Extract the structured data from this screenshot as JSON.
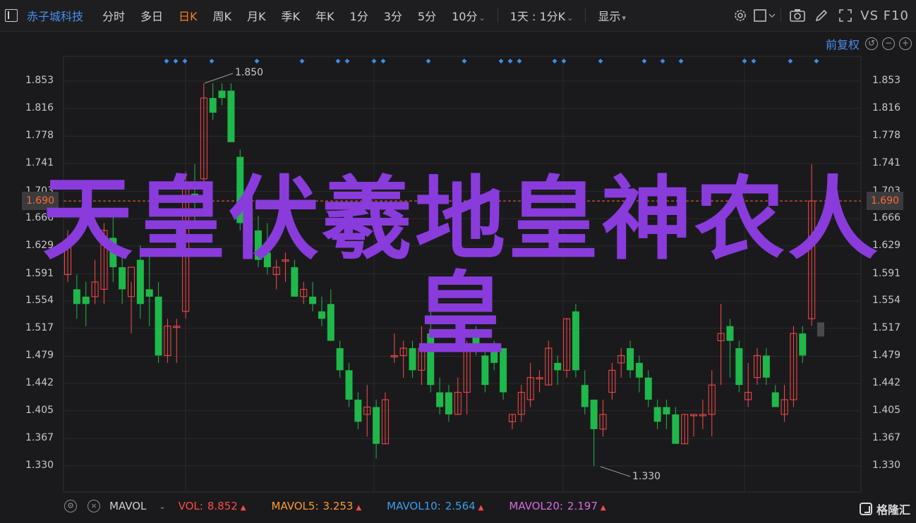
{
  "toolbar": {
    "stock_name": "赤子城科技",
    "periods": [
      "分时",
      "多日",
      "日K",
      "周K",
      "月K",
      "季K",
      "年K",
      "1分",
      "3分",
      "5分",
      "10分"
    ],
    "active_period": "日K",
    "combo_label": "1天 : 1分K",
    "display_label": "显示",
    "vs_label": "VS",
    "f10_label": "F10"
  },
  "chart": {
    "fq_label": "前复权",
    "price_levels": [
      "1.853",
      "1.816",
      "1.778",
      "1.741",
      "1.703",
      "1.666",
      "1.629",
      "1.591",
      "1.554",
      "1.517",
      "1.479",
      "1.442",
      "1.405",
      "1.367",
      "1.330"
    ],
    "current_price": "1.690",
    "high_annotation": "1.850",
    "low_annotation": "1.330",
    "colors": {
      "up": "#ff4a4a",
      "down": "#1fb84a",
      "current_line": "#ff6a33",
      "marker": "#3a8fe8"
    }
  },
  "chart_data": {
    "type": "candlestick",
    "ylim": [
      1.31,
      1.87
    ],
    "candles": [
      {
        "o": 1.59,
        "h": 1.65,
        "l": 1.58,
        "c": 1.63
      },
      {
        "o": 1.57,
        "h": 1.59,
        "l": 1.53,
        "c": 1.55
      },
      {
        "o": 1.56,
        "h": 1.58,
        "l": 1.52,
        "c": 1.55
      },
      {
        "o": 1.56,
        "h": 1.61,
        "l": 1.55,
        "c": 1.58
      },
      {
        "o": 1.57,
        "h": 1.66,
        "l": 1.55,
        "c": 1.65
      },
      {
        "o": 1.64,
        "h": 1.67,
        "l": 1.58,
        "c": 1.6
      },
      {
        "o": 1.6,
        "h": 1.62,
        "l": 1.55,
        "c": 1.57
      },
      {
        "o": 1.56,
        "h": 1.58,
        "l": 1.51,
        "c": 1.6
      },
      {
        "o": 1.61,
        "h": 1.63,
        "l": 1.53,
        "c": 1.55
      },
      {
        "o": 1.57,
        "h": 1.62,
        "l": 1.52,
        "c": 1.56
      },
      {
        "o": 1.56,
        "h": 1.58,
        "l": 1.47,
        "c": 1.48
      },
      {
        "o": 1.48,
        "h": 1.53,
        "l": 1.47,
        "c": 1.52
      },
      {
        "o": 1.52,
        "h": 1.53,
        "l": 1.47,
        "c": 1.52
      },
      {
        "o": 1.54,
        "h": 1.73,
        "l": 1.53,
        "c": 1.71
      },
      {
        "o": 1.7,
        "h": 1.74,
        "l": 1.66,
        "c": 1.69
      },
      {
        "o": 1.72,
        "h": 1.85,
        "l": 1.7,
        "c": 1.83
      },
      {
        "o": 1.83,
        "h": 1.85,
        "l": 1.8,
        "c": 1.81
      },
      {
        "o": 1.84,
        "h": 1.85,
        "l": 1.82,
        "c": 1.83
      },
      {
        "o": 1.84,
        "h": 1.85,
        "l": 1.77,
        "c": 1.77
      },
      {
        "o": 1.75,
        "h": 1.76,
        "l": 1.65,
        "c": 1.66
      },
      {
        "o": 1.68,
        "h": 1.7,
        "l": 1.62,
        "c": 1.63
      },
      {
        "o": 1.65,
        "h": 1.67,
        "l": 1.6,
        "c": 1.61
      },
      {
        "o": 1.62,
        "h": 1.66,
        "l": 1.59,
        "c": 1.6
      },
      {
        "o": 1.59,
        "h": 1.61,
        "l": 1.57,
        "c": 1.6
      },
      {
        "o": 1.61,
        "h": 1.62,
        "l": 1.58,
        "c": 1.61
      },
      {
        "o": 1.6,
        "h": 1.61,
        "l": 1.56,
        "c": 1.56
      },
      {
        "o": 1.56,
        "h": 1.58,
        "l": 1.55,
        "c": 1.57
      },
      {
        "o": 1.56,
        "h": 1.58,
        "l": 1.54,
        "c": 1.55
      },
      {
        "o": 1.54,
        "h": 1.56,
        "l": 1.52,
        "c": 1.53
      },
      {
        "o": 1.55,
        "h": 1.57,
        "l": 1.5,
        "c": 1.5
      },
      {
        "o": 1.49,
        "h": 1.5,
        "l": 1.45,
        "c": 1.46
      },
      {
        "o": 1.46,
        "h": 1.47,
        "l": 1.41,
        "c": 1.42
      },
      {
        "o": 1.42,
        "h": 1.43,
        "l": 1.38,
        "c": 1.39
      },
      {
        "o": 1.4,
        "h": 1.44,
        "l": 1.37,
        "c": 1.41
      },
      {
        "o": 1.41,
        "h": 1.42,
        "l": 1.34,
        "c": 1.36
      },
      {
        "o": 1.36,
        "h": 1.43,
        "l": 1.36,
        "c": 1.42
      },
      {
        "o": 1.48,
        "h": 1.51,
        "l": 1.47,
        "c": 1.48
      },
      {
        "o": 1.48,
        "h": 1.5,
        "l": 1.45,
        "c": 1.49
      },
      {
        "o": 1.49,
        "h": 1.5,
        "l": 1.45,
        "c": 1.46
      },
      {
        "o": 1.46,
        "h": 1.52,
        "l": 1.44,
        "c": 1.49
      },
      {
        "o": 1.51,
        "h": 1.54,
        "l": 1.43,
        "c": 1.44
      },
      {
        "o": 1.43,
        "h": 1.45,
        "l": 1.4,
        "c": 1.41
      },
      {
        "o": 1.43,
        "h": 1.44,
        "l": 1.39,
        "c": 1.4
      },
      {
        "o": 1.4,
        "h": 1.45,
        "l": 1.4,
        "c": 1.43
      },
      {
        "o": 1.43,
        "h": 1.5,
        "l": 1.4,
        "c": 1.49
      },
      {
        "o": 1.51,
        "h": 1.52,
        "l": 1.48,
        "c": 1.49
      },
      {
        "o": 1.48,
        "h": 1.49,
        "l": 1.43,
        "c": 1.44
      },
      {
        "o": 1.49,
        "h": 1.5,
        "l": 1.46,
        "c": 1.47
      },
      {
        "o": 1.49,
        "h": 1.49,
        "l": 1.42,
        "c": 1.43
      },
      {
        "o": 1.39,
        "h": 1.4,
        "l": 1.38,
        "c": 1.4
      },
      {
        "o": 1.4,
        "h": 1.44,
        "l": 1.39,
        "c": 1.43
      },
      {
        "o": 1.42,
        "h": 1.47,
        "l": 1.41,
        "c": 1.45
      },
      {
        "o": 1.45,
        "h": 1.46,
        "l": 1.43,
        "c": 1.45
      },
      {
        "o": 1.44,
        "h": 1.5,
        "l": 1.44,
        "c": 1.49
      },
      {
        "o": 1.47,
        "h": 1.48,
        "l": 1.44,
        "c": 1.46
      },
      {
        "o": 1.46,
        "h": 1.53,
        "l": 1.45,
        "c": 1.53
      },
      {
        "o": 1.54,
        "h": 1.55,
        "l": 1.45,
        "c": 1.46
      },
      {
        "o": 1.44,
        "h": 1.46,
        "l": 1.4,
        "c": 1.41
      },
      {
        "o": 1.42,
        "h": 1.42,
        "l": 1.33,
        "c": 1.38
      },
      {
        "o": 1.38,
        "h": 1.42,
        "l": 1.37,
        "c": 1.4
      },
      {
        "o": 1.43,
        "h": 1.47,
        "l": 1.42,
        "c": 1.46
      },
      {
        "o": 1.47,
        "h": 1.49,
        "l": 1.45,
        "c": 1.48
      },
      {
        "o": 1.49,
        "h": 1.5,
        "l": 1.45,
        "c": 1.46
      },
      {
        "o": 1.47,
        "h": 1.48,
        "l": 1.43,
        "c": 1.45
      },
      {
        "o": 1.45,
        "h": 1.46,
        "l": 1.41,
        "c": 1.42
      },
      {
        "o": 1.41,
        "h": 1.42,
        "l": 1.38,
        "c": 1.39
      },
      {
        "o": 1.41,
        "h": 1.42,
        "l": 1.38,
        "c": 1.4
      },
      {
        "o": 1.4,
        "h": 1.41,
        "l": 1.36,
        "c": 1.36
      },
      {
        "o": 1.36,
        "h": 1.4,
        "l": 1.36,
        "c": 1.4
      },
      {
        "o": 1.4,
        "h": 1.4,
        "l": 1.37,
        "c": 1.4
      },
      {
        "o": 1.4,
        "h": 1.42,
        "l": 1.38,
        "c": 1.4
      },
      {
        "o": 1.4,
        "h": 1.46,
        "l": 1.37,
        "c": 1.44
      },
      {
        "o": 1.5,
        "h": 1.55,
        "l": 1.44,
        "c": 1.51
      },
      {
        "o": 1.52,
        "h": 1.53,
        "l": 1.45,
        "c": 1.5
      },
      {
        "o": 1.49,
        "h": 1.5,
        "l": 1.43,
        "c": 1.44
      },
      {
        "o": 1.42,
        "h": 1.47,
        "l": 1.41,
        "c": 1.43
      },
      {
        "o": 1.45,
        "h": 1.49,
        "l": 1.44,
        "c": 1.48
      },
      {
        "o": 1.48,
        "h": 1.49,
        "l": 1.44,
        "c": 1.45
      },
      {
        "o": 1.43,
        "h": 1.44,
        "l": 1.41,
        "c": 1.41
      },
      {
        "o": 1.4,
        "h": 1.44,
        "l": 1.39,
        "c": 1.42
      },
      {
        "o": 1.42,
        "h": 1.52,
        "l": 1.41,
        "c": 1.51
      },
      {
        "o": 1.51,
        "h": 1.52,
        "l": 1.47,
        "c": 1.48
      },
      {
        "o": 1.53,
        "h": 1.74,
        "l": 1.52,
        "c": 1.69
      },
      {
        "o": 1.52,
        "h": 1.52,
        "l": 1.52,
        "c": 1.52
      }
    ]
  },
  "markers": [
    "◆"
  ],
  "volume_bar": {
    "name": "MAVOL",
    "indicators": [
      {
        "label": "VOL:",
        "value": "8.852",
        "color": "#ff4a4a"
      },
      {
        "label": "MAVOL5:",
        "value": "3.253",
        "color": "#ff9a2e"
      },
      {
        "label": "MAVOL10:",
        "value": "2.564",
        "color": "#3a9ff0"
      },
      {
        "label": "MAVOL20:",
        "value": "2.197",
        "color": "#d66be0"
      }
    ]
  },
  "watermark_text": "天皇伏羲地皇神农人皇",
  "logo_text": "格隆汇"
}
